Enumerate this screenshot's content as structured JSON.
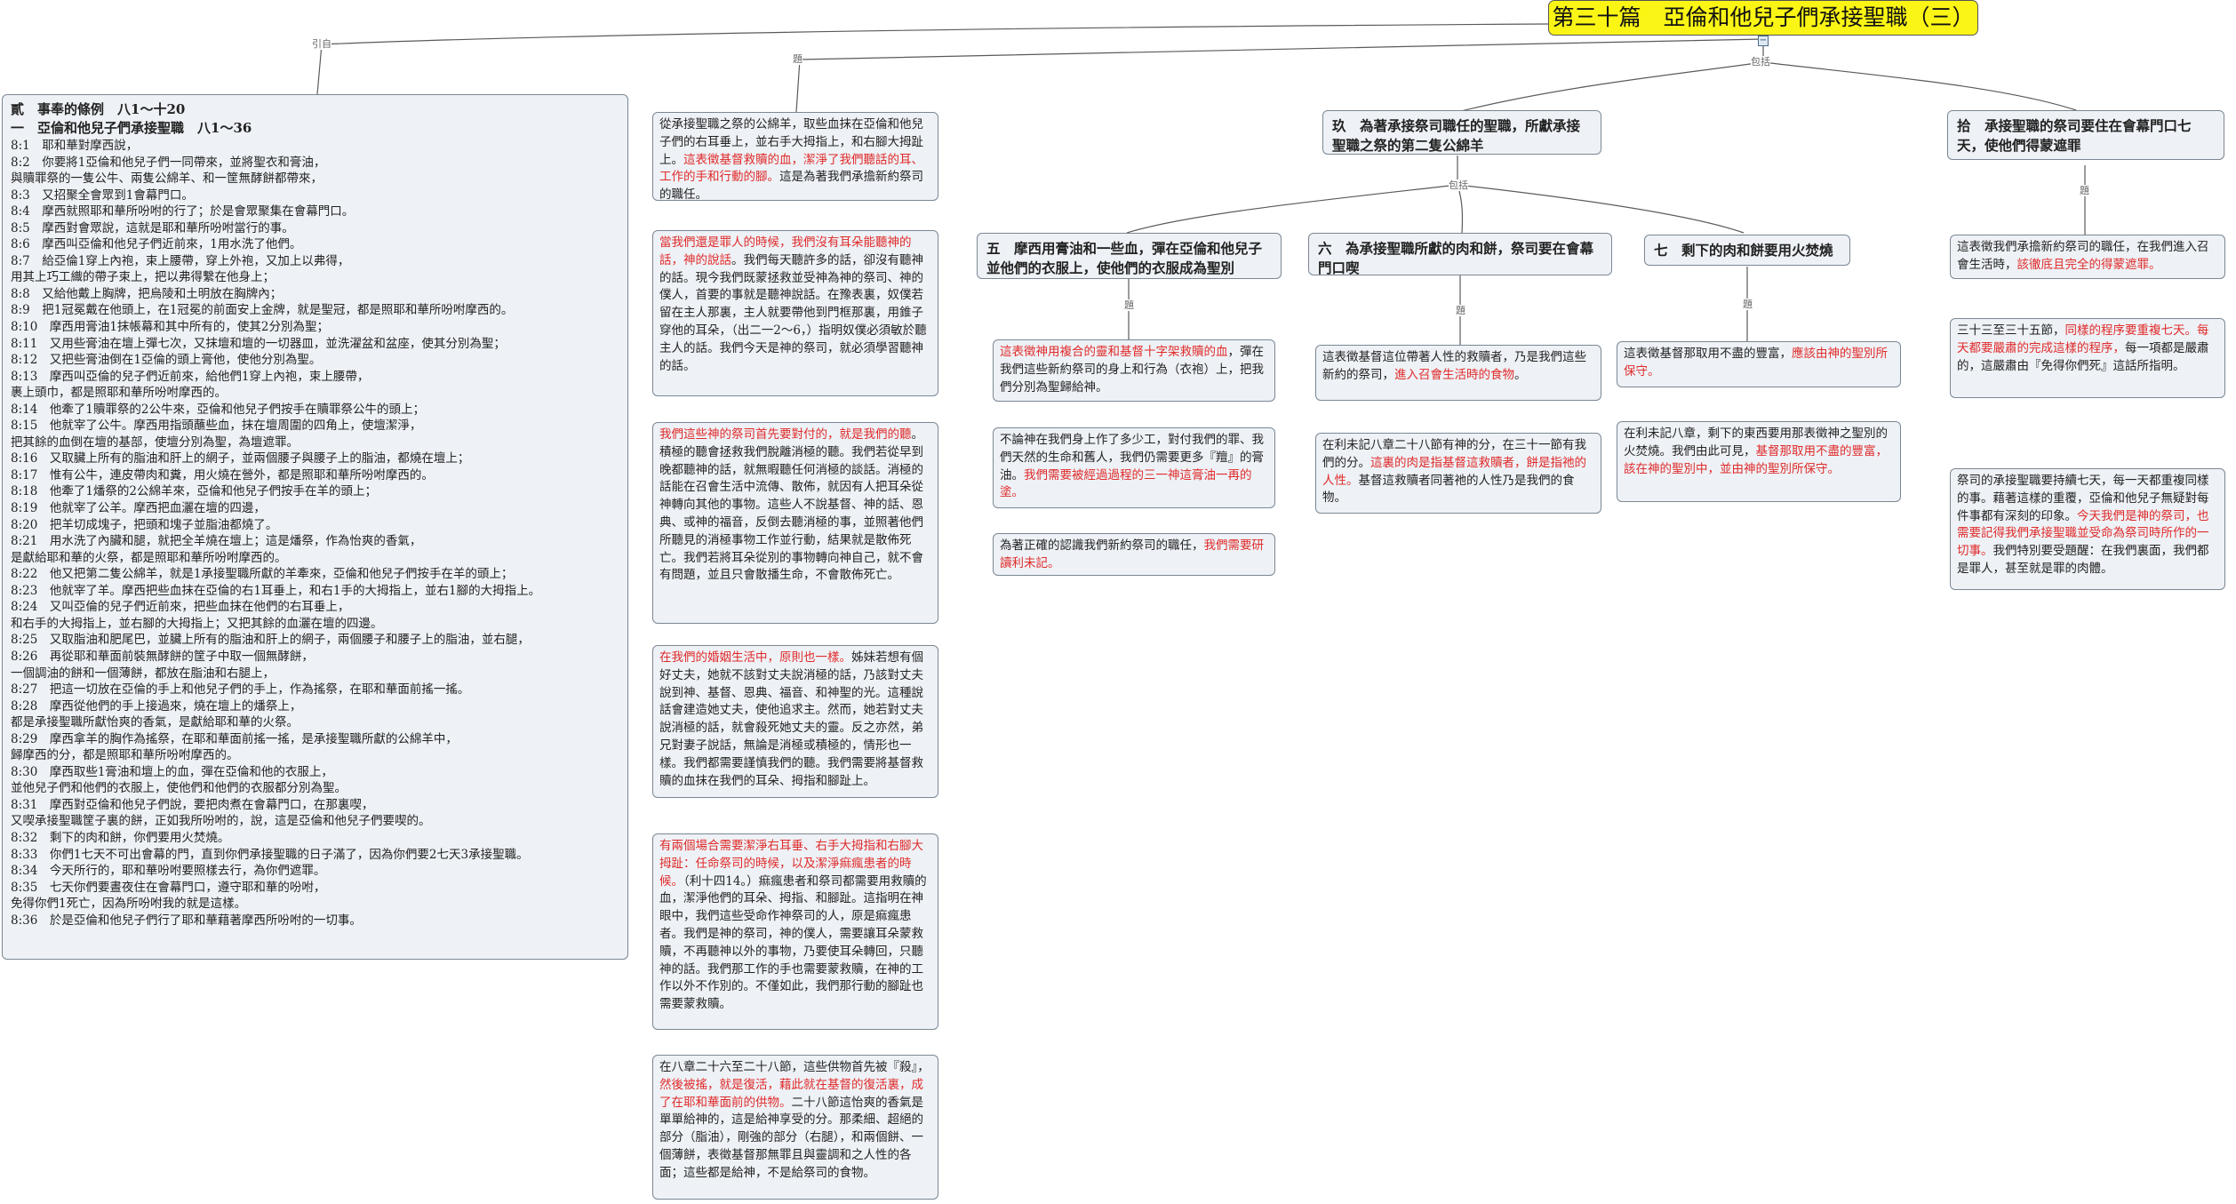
{
  "title": "第三十篇　亞倫和他兒子們承接聖職（三）",
  "collapse_glyph": "−",
  "relations": {
    "citation": "引自",
    "body": "題",
    "includes": "包括"
  },
  "scripture": {
    "heading1": "貳　事奉的條例　八1～十20",
    "heading2": "一　亞倫和他兒子們承接聖職　八1～36",
    "verses": [
      "8:1　耶和華對摩西說，",
      "8:2　你要將1亞倫和他兒子們一同帶來，並將聖衣和膏油，",
      "與贖罪祭的一隻公牛、兩隻公綿羊、和一筐無酵餅都帶來，",
      "8:3　又招聚全會眾到1會幕門口。",
      "8:4　摩西就照耶和華所吩咐的行了；於是會眾聚集在會幕門口。",
      "8:5　摩西對會眾說，這就是耶和華所吩咐當行的事。",
      "8:6　摩西叫亞倫和他兒子們近前來，1用水洗了他們。",
      "8:7　給亞倫1穿上內袍，束上腰帶，穿上外袍，又加上以弗得，",
      "用其上巧工織的帶子束上，把以弗得繫在他身上；",
      "8:8　又給他戴上胸牌，把烏陵和土明放在胸牌內；",
      "8:9　把1冠冕戴在他頭上，在1冠冕的前面安上金牌，就是聖冠，都是照耶和華所吩咐摩西的。",
      "8:10　摩西用膏油1抹帳幕和其中所有的，使其2分別為聖；",
      "8:11　又用些膏油在壇上彈七次，又抹壇和壇的一切器皿，並洗濯盆和盆座，使其分別為聖；",
      "8:12　又把些膏油倒在1亞倫的頭上膏他，使他分別為聖。",
      "8:13　摩西叫亞倫的兒子們近前來，給他們1穿上內袍，束上腰帶，",
      "裹上頭巾，都是照耶和華所吩咐摩西的。",
      "8:14　他牽了1贖罪祭的2公牛來，亞倫和他兒子們按手在贖罪祭公牛的頭上；",
      "8:15　他就宰了公牛。摩西用指頭蘸些血，抹在壇周圍的四角上，使壇潔淨，",
      "把其餘的血倒在壇的基部，使壇分別為聖，為壇遮罪。",
      "8:16　又取臟上所有的脂油和肝上的網子，並兩個腰子與腰子上的脂油，都燒在壇上；",
      "8:17　惟有公牛，連皮帶肉和糞，用火燒在營外，都是照耶和華所吩咐摩西的。",
      "8:18　他牽了1燔祭的2公綿羊來，亞倫和他兒子們按手在羊的頭上；",
      "8:19　他就宰了公羊。摩西把血灑在壇的四邊，",
      "8:20　把羊切成塊子，把頭和塊子並脂油都燒了。",
      "8:21　用水洗了內臟和腿，就把全羊燒在壇上；這是燔祭，作為怡爽的香氣，",
      "是獻給耶和華的火祭，都是照耶和華所吩咐摩西的。",
      "8:22　他又把第二隻公綿羊，就是1承接聖職所獻的羊牽來，亞倫和他兒子們按手在羊的頭上；",
      "8:23　他就宰了羊。摩西把些血抹在亞倫的右1耳垂上，和右1手的大拇指上，並右1腳的大拇指上。",
      "8:24　又叫亞倫的兒子們近前來，把些血抹在他們的右耳垂上，",
      "和右手的大拇指上，並右腳的大拇指上；又把其餘的血灑在壇的四邊。",
      "8:25　又取脂油和肥尾巴，並臟上所有的脂油和肝上的網子，兩個腰子和腰子上的脂油，並右腿，",
      "8:26　再從耶和華面前裝無酵餅的筐子中取一個無酵餅，",
      "一個調油的餅和一個薄餅，都放在脂油和右腿上，",
      "8:27　把這一切放在亞倫的手上和他兒子們的手上，作為搖祭，在耶和華面前搖一搖。",
      "8:28　摩西從他們的手上接過來，燒在壇上的燔祭上，",
      "都是承接聖職所獻怡爽的香氣，是獻給耶和華的火祭。",
      "8:29　摩西拿羊的胸作為搖祭，在耶和華面前搖一搖，是承接聖職所獻的公綿羊中，",
      "歸摩西的分，都是照耶和華所吩咐摩西的。",
      "8:30　摩西取些1膏油和壇上的血，彈在亞倫和他的衣服上，",
      "並他兒子們和他們的衣服上，使他們和他們的衣服都分別為聖。",
      "8:31　摩西對亞倫和他兒子們說，要把肉煮在會幕門口，在那裏喫，",
      "又喫承接聖職筐子裏的餅，正如我所吩咐的，說，這是亞倫和他兒子們要喫的。",
      "8:32　剩下的肉和餅，你們要用火焚燒。",
      "8:33　你們1七天不可出會幕的門，直到你們承接聖職的日子滿了，因為你們要2七天3承接聖職。",
      "8:34　今天所行的，耶和華吩咐要照樣去行，為你們遮罪。",
      "8:35　七天你們要晝夜住在會幕門口，遵守耶和華的吩咐，",
      "免得你們1死亡，因為所吩咐我的就是這樣。",
      "8:36　於是亞倫和他兒子們行了耶和華藉著摩西所吩咐的一切事。"
    ]
  },
  "mid_nodes": [
    {
      "parts": [
        {
          "t": "從承接聖職之祭的公綿羊，取些血抹在亞倫和他兒子們的右耳垂上，並右手大拇指上，和右腳大拇趾上。",
          "r": false
        },
        {
          "t": "這表徵基督救贖的血，潔淨了我們聽話的耳、工作的手和行動的腳。",
          "r": true
        },
        {
          "t": "這是為著我們承擔新約祭司的職任。",
          "r": false
        }
      ]
    },
    {
      "parts": [
        {
          "t": "當我們還是罪人的時候，我們沒有耳朵能聽神的話，神的說話",
          "r": true
        },
        {
          "t": "。我們每天聽許多的話，卻沒有聽神的話。現今我們既蒙拯救並受神為神的祭司、神的僕人，首要的事就是聽神說話。在豫表裏，奴僕若留在主人那裏，主人就要帶他到門框那裏，用錐子穿他的耳朵，（出二一2～6，）指明奴僕必須敏於聽主人的話。我們今天是神的祭司，就必須學習聽神的話。",
          "r": false
        }
      ]
    },
    {
      "parts": [
        {
          "t": "我們這些神的祭司首先要對付的，就是我們的聽",
          "r": true
        },
        {
          "t": "。積極的聽會拯救我們脫離消極的聽。我們若從早到晚都聽神的話，就無暇聽任何消極的談話。消極的話能在召會生活中流傳、散佈，就因有人把耳朵從神轉向其他的事物。這些人不說基督、神的話、恩典、或神的福音，反倒去聽消極的事，並照著他們所聽見的消極事物工作並行動，結果就是散佈死亡。我們若將耳朵從別的事物轉向神自己，就不會有問題，並且只會散播生命，不會散佈死亡。",
          "r": false
        }
      ]
    },
    {
      "parts": [
        {
          "t": "在我們的婚姻生活中，原則也一樣。",
          "r": true
        },
        {
          "t": "姊妹若想有個好丈夫，她就不該對丈夫說消極的話，乃該對丈夫說到神、基督、恩典、福音、和神聖的光。這種說話會建造她丈夫，使他追求主。然而，她若對丈夫說消極的話，就會殺死她丈夫的靈。反之亦然，弟兄對妻子說話，無論是消極或積極的，情形也一樣。我們都需要謹慎我們的聽。我們需要將基督救贖的血抹在我們的耳朵、拇指和腳趾上。",
          "r": false
        }
      ]
    },
    {
      "parts": [
        {
          "t": "有兩個場合需要潔淨右耳垂、右手大拇指和右腳大拇趾：任命祭司的時候，以及潔淨痲瘋患者的時候。",
          "r": true
        },
        {
          "t": "（利十四14。）痲瘋患者和祭司都需要用救贖的血，潔淨他們的耳朵、拇指、和腳趾。這指明在神眼中，我們這些受命作神祭司的人，原是痲瘋患者。我們是神的祭司，神的僕人，需要讓耳朵蒙救贖，不再聽神以外的事物，乃要使耳朵轉回，只聽神的話。我們那工作的手也需要蒙救贖，在神的工作以外不作別的。不僅如此，我們那行動的腳趾也需要蒙救贖。",
          "r": false
        }
      ]
    },
    {
      "parts": [
        {
          "t": "在八章二十六至二十八節，這些供物首先被『殺』，",
          "r": false
        },
        {
          "t": "然後被搖，就是復活，藉此就在基督的復活裏，成了在耶和華面前的供物。",
          "r": true
        },
        {
          "t": "二十八節這怡爽的香氣是單單給神的，這是給神享受的分。那柔細、超絕的部分（脂油），剛強的部分（右腿），和兩個餅、一個薄餅，表徵基督那無罪且與靈調和之人性的各面；這些都是給神，不是給祭司的食物。",
          "r": false
        }
      ]
    }
  ],
  "branch9": {
    "title": "玖　為著承接祭司職任的聖職，所獻承接聖職之祭的第二隻公綿羊",
    "sub5": {
      "title": "五　摩西用膏油和一些血，彈在亞倫和他兒子並他們的衣服上，使他們的衣服成為聖別",
      "notes": [
        {
          "parts": [
            {
              "t": "這表徵神用複合的靈和基督十字架救贖的血",
              "r": true
            },
            {
              "t": "，彈在我們這些新約祭司的身上和行為（衣袍）上，把我們分別為聖歸給神。",
              "r": false
            }
          ]
        },
        {
          "parts": [
            {
              "t": "不論神在我們身上作了多少工，對付我們的罪、我們天然的生命和舊人，我們仍需要更多『羶』的膏油。",
              "r": false
            },
            {
              "t": "我們需要被經過過程的三一神這膏油一再的塗。",
              "r": true
            }
          ]
        },
        {
          "parts": [
            {
              "t": "為著正確的認識我們新約祭司的職任，",
              "r": false
            },
            {
              "t": "我們需要研讀利未記。",
              "r": true
            }
          ]
        }
      ]
    },
    "sub6": {
      "title": "六　為承接聖職所獻的肉和餅，祭司要在會幕門口喫",
      "notes": [
        {
          "parts": [
            {
              "t": "這表徵基督這位帶著人性的救贖者，乃是我們這些新約的祭司，",
              "r": false
            },
            {
              "t": "進入召會生活時的食物",
              "r": true
            },
            {
              "t": "。",
              "r": false
            }
          ]
        },
        {
          "parts": [
            {
              "t": "在利未記八章二十八節有神的分，在三十一節有我們的分。",
              "r": false
            },
            {
              "t": "這裏的肉是指基督這救贖者，餅是指祂的人性。",
              "r": true
            },
            {
              "t": "基督這救贖者同著祂的人性乃是我們的食物。",
              "r": false
            }
          ]
        }
      ]
    },
    "sub7": {
      "title": "七　剩下的肉和餅要用火焚燒",
      "notes": [
        {
          "parts": [
            {
              "t": "這表徵基督那取用不盡的豐富，",
              "r": false
            },
            {
              "t": "應該由神的聖別所保守。",
              "r": true
            }
          ]
        },
        {
          "parts": [
            {
              "t": "在利未記八章，剩下的東西要用那表徵神之聖別的火焚燒。我們由此可見，",
              "r": false
            },
            {
              "t": "基督那取用不盡的豐富，該在神的聖別中，並由神的聖別所保守。",
              "r": true
            }
          ]
        }
      ]
    }
  },
  "branch10": {
    "title": "拾　承接聖職的祭司要住在會幕門口七天，使他們得蒙遮罪",
    "notes": [
      {
        "parts": [
          {
            "t": "這表徵我們承擔新約祭司的職任，在我們進入召會生活時，",
            "r": false
          },
          {
            "t": "該徹底且完全的得蒙遮罪。",
            "r": true
          }
        ]
      },
      {
        "parts": [
          {
            "t": "三十三至三十五節，",
            "r": false
          },
          {
            "t": "同樣的程序要重複七天。每天都要嚴肅的完成這樣的程序，",
            "r": true
          },
          {
            "t": "每一項都是嚴肅的，這嚴肅由『免得你們死』這話所指明。",
            "r": false
          }
        ]
      },
      {
        "parts": [
          {
            "t": "祭司的承接聖職要持續七天，每一天都重複同樣的事。藉著這樣的重覆，亞倫和他兒子無疑對每件事都有深刻的印象。",
            "r": false
          },
          {
            "t": "今天我們是神的祭司，也需要記得我們承接聖職並受命為祭司時所作的一切事。",
            "r": true
          },
          {
            "t": "我們特別要受題醒：在我們裏面，我們都是罪人，甚至就是罪的肉體。",
            "r": false
          }
        ]
      }
    ]
  }
}
